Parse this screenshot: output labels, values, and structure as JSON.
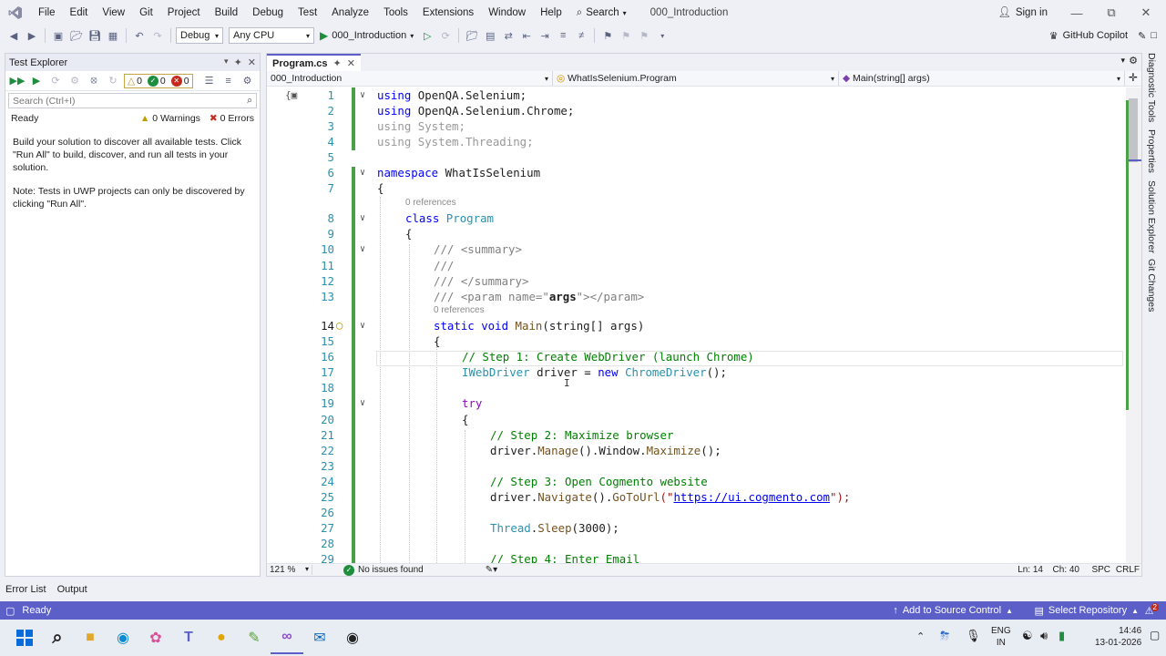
{
  "menubar": {
    "items": [
      "File",
      "Edit",
      "View",
      "Git",
      "Project",
      "Build",
      "Debug",
      "Test",
      "Analyze",
      "Tools",
      "Extensions",
      "Window",
      "Help"
    ],
    "search_label": "Search",
    "solution_name": "000_Introduction",
    "signin_label": "Sign in"
  },
  "toolbar": {
    "config": "Debug",
    "platform": "Any CPU",
    "start_target": "000_Introduction",
    "copilot_label": "GitHub Copilot"
  },
  "test_explorer": {
    "title": "Test Explorer",
    "count_warn": "0",
    "count_pass": "0",
    "count_fail": "0",
    "search_placeholder": "Search (Ctrl+I)",
    "status": "Ready",
    "warnings": "0 Warnings",
    "errors": "0 Errors",
    "msg1": "Build your solution to discover all available tests. Click \"Run All\" to build, discover, and run all tests in your solution.",
    "msg2": "Note: Tests in UWP projects can only be discovered by clicking \"Run All\"."
  },
  "editor": {
    "tab_label": "Program.cs",
    "nav_project": "000_Introduction",
    "nav_class": "WhatIsSelenium.Program",
    "nav_member": "Main(string[] args)",
    "codelens": "0 references",
    "zoom": "121 %",
    "issues": "No issues found",
    "ln": "Ln: 14",
    "ch": "Ch: 40",
    "spc": "SPC",
    "crlf": "CRLF",
    "code": {
      "l1_kw": "using",
      "l1_rest": " OpenQA.Selenium;",
      "l2_kw": "using",
      "l2_rest": " OpenQA.Selenium.Chrome;",
      "l3": "using System;",
      "l4": "using System.Threading;",
      "l6_kw": "namespace",
      "l6_rest": " WhatIsSelenium",
      "l7": "{",
      "l8_kw": "class",
      "l8_ty": " Program",
      "l9": "{",
      "l10_a": "/// ",
      "l10_b": "<summary>",
      "l11": "///",
      "l12_a": "/// ",
      "l12_b": "</summary>",
      "l13_a": "/// ",
      "l13_b": "<param name=\"",
      "l13_c": "args",
      "l13_d": "\"></param>",
      "l14_kw1": "static",
      "l14_kw2": " void",
      "l14_m": " Main",
      "l14_rest": "(string[] args)",
      "l15": "{",
      "l16": "// Step 1: Create WebDriver (launch Chrome)",
      "l17_ty": "IWebDriver",
      "l17_mid": " driver = ",
      "l17_kw": "new",
      "l17_ty2": " ChromeDriver",
      "l17_end": "();",
      "l19": "try",
      "l20": "{",
      "l21": "// Step 2: Maximize browser",
      "l22_a": "driver.",
      "l22_m1": "Manage",
      "l22_b": "().Window.",
      "l22_m2": "Maximize",
      "l22_c": "();",
      "l24": "// Step 3: Open Cogmento website",
      "l25_a": "driver.",
      "l25_m1": "Navigate",
      "l25_b": "().",
      "l25_m2": "GoToUrl",
      "l25_c": "(\"",
      "l25_url": "https://ui.cogmento.com",
      "l25_d": "\");",
      "l27_ty": "Thread",
      "l27_a": ".",
      "l27_m": "Sleep",
      "l27_b": "(3000);",
      "l29": "// Step 4: Enter Email"
    }
  },
  "right_tabs": [
    "Diagnostic Tools",
    "Properties",
    "Solution Explorer",
    "Git Changes"
  ],
  "bottom_tabs": [
    "Error List",
    "Output"
  ],
  "statusbar": {
    "ready": "Ready",
    "source_control": "Add to Source Control",
    "repository": "Select Repository",
    "notif_count": "2"
  },
  "taskbar": {
    "lang_top": "ENG",
    "lang_bottom": "IN",
    "time": "14:46",
    "date": "13-01-2026"
  }
}
